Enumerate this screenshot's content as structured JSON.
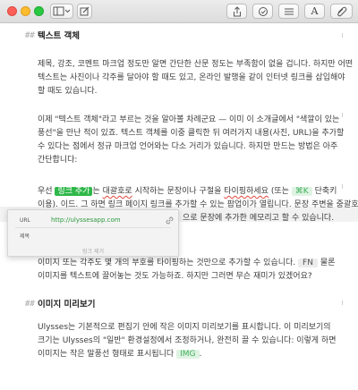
{
  "toolbar": {
    "buttons": [
      {
        "name": "sidebar-toggle-button",
        "icon": "sidebar-icon"
      },
      {
        "name": "compose-button",
        "icon": "compose-icon"
      },
      {
        "name": "share-button",
        "icon": "share-icon"
      },
      {
        "name": "goals-button",
        "icon": "goals-icon"
      },
      {
        "name": "list-button",
        "icon": "list-icon"
      },
      {
        "name": "typography-button",
        "icon": "typography-icon"
      },
      {
        "name": "attachments-button",
        "icon": "paperclip-icon"
      }
    ],
    "typography_glyph": "A"
  },
  "doc": {
    "heading1": "텍스트 객체",
    "heading1_mark": "##",
    "p1": [
      "제목, 강조, 코멘트 마크업 정도만 알면 간단한 산문 정도는 부족함이 없을 겁니다. 하지만 어떤",
      "텍스트는 사진이나 각주를 달아야 할 때도 있고, 온라인 발행을 같이 인터넷 링크를 삽입해야",
      "할 때도 있습니다."
    ],
    "p2": [
      "이제 \"텍스트 객체\"라고 부르는 것을 알아볼 차례군요 — 이미 이 소개글에서 \"색깔이 있는",
      "풍선\"을 만난 적이 있죠. 텍스트 객체를 이중 클릭한 뒤 여러가지 내용(사진, URL)을 추가할",
      "수 있다는 점에서 정규 마크업 언어와는 다소 거리가 있습니다. 하지만 만드는 방법은 아주",
      "간단합니다:"
    ],
    "p3_line1_pre": "우선",
    "p3_link_tag": "링크 추가",
    "p3_line1_mid1": "는",
    "p3_line1_mid2": "대괄호로",
    "p3_line1_mid3": "시작하는 문장이나 구절을",
    "p3_line1_mid4": "타이핑하세요",
    "p3_line1_mid5": "(또는",
    "p3_shortcut": "⌘K",
    "p3_line1_post": "단축키",
    "p3_line2": "이용). 이드. 그 하면 링크 페이지 링크를 추가할 수 있는 팝업이가 열립니다. 문장 주변을 중괄호로",
    "p3_line3": "으로 문장에 추가한 메모리고 할 수 있습니다.",
    "p4_line1_pre": "이미지 또는 각주도 몇 개의 부호를 타이핑하는 것만으로 추가할 수 있습니다.",
    "p4_fn_tag": "FN",
    "p4_line1_post": "물론",
    "p4_line2": "이미지를 텍스트에 끌어놓는 것도 가능하죠. 하지만 그러면 무슨 재미가 있겠어요?",
    "heading2": "이미지 미리보기",
    "heading2_mark": "##",
    "p5": [
      "Ulysses는 기본적으로 편집기 안에 작은 이미지 미리보기를 표시합니다. 이 미리보기의",
      "크기는 Ulysses의 \"일반\" 환경설정에서 조정하거나, 완전히 끌 수 있습니다: 이렇게 하면"
    ],
    "p5_line3_pre": "이미지는 작은 말풍선 형태로 표시됩니다",
    "p5_img_tag": "IMG",
    "p5_line3_post": "."
  },
  "popup": {
    "url_label": "URL",
    "url_value": "http://ulyssesapp.com",
    "title_label": "제목",
    "title_value": "",
    "remove_label": "링크 제거"
  },
  "colors": {
    "accent_green": "#2fb84a",
    "link_text": "#2d9a3e",
    "spell_underline": "#e0463e"
  }
}
